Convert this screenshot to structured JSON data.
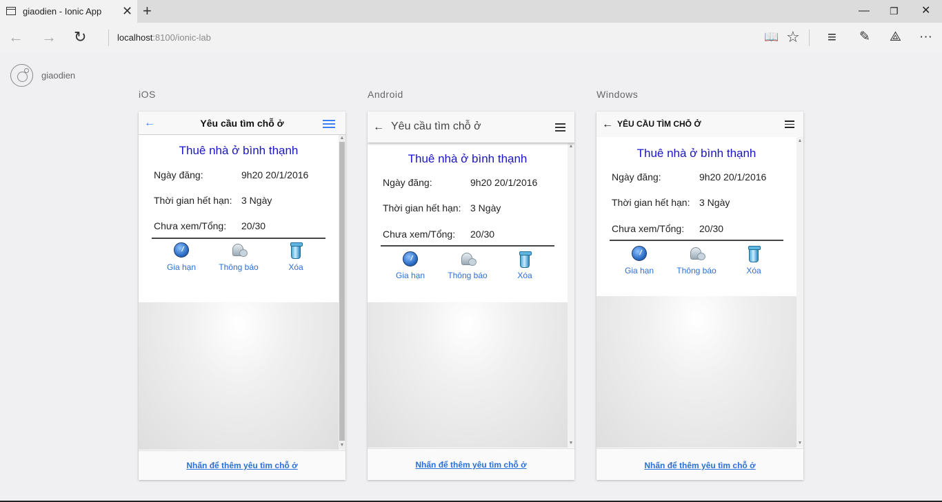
{
  "browser": {
    "tab_title": "giaodien - Ionic App",
    "tab_close": "✕",
    "new_tab": "+",
    "url_host": "localhost",
    "url_path": ":8100/ionic-lab",
    "controls": {
      "minimize": "—",
      "restore": "❐",
      "close": "✕"
    },
    "nav": {
      "back": "←",
      "forward": "→",
      "refresh": "↻"
    },
    "tools": {
      "reading_view": "📖",
      "favorite": "☆",
      "hub": "≡",
      "web_note": "✎",
      "share": "⟁",
      "more": "···"
    }
  },
  "app": {
    "name": "giaodien"
  },
  "platforms": [
    {
      "label": "iOS",
      "header_title": "Yêu cầu tìm chỗ ở",
      "back": "←",
      "post_title": "Thuê nhà ở bình thạnh",
      "rows": [
        {
          "label": "Ngày đăng:",
          "value": "9h20 20/1/2016"
        },
        {
          "label": "Thời gian hết hạn:",
          "value": "3 Ngày"
        },
        {
          "label": "Chưa xem/Tổng:",
          "value": "20/30"
        }
      ],
      "actions": [
        "Gia hạn",
        "Thông báo",
        "Xóa"
      ],
      "footer_link": "Nhấn để thêm yêu tìm chỗ ở"
    },
    {
      "label": "Android",
      "header_title": "Yêu cầu tìm chỗ ở",
      "back": "←",
      "post_title": "Thuê nhà ở bình thạnh",
      "rows": [
        {
          "label": "Ngày đăng:",
          "value": "9h20 20/1/2016"
        },
        {
          "label": "Thời gian hết hạn:",
          "value": "3 Ngày"
        },
        {
          "label": "Chưa xem/Tổng:",
          "value": "20/30"
        }
      ],
      "actions": [
        "Gia hạn",
        "Thông báo",
        "Xóa"
      ],
      "footer_link": "Nhấn để thêm yêu tìm chỗ ở"
    },
    {
      "label": "Windows",
      "header_title": "YÊU CẦU TÌM CHỖ Ở",
      "back": "←",
      "post_title": "Thuê nhà ở bình thạnh",
      "rows": [
        {
          "label": "Ngày đăng:",
          "value": "9h20 20/1/2016"
        },
        {
          "label": "Thời gian hết hạn:",
          "value": "3 Ngày"
        },
        {
          "label": "Chưa xem/Tổng:",
          "value": "20/30"
        }
      ],
      "actions": [
        "Gia hạn",
        "Thông báo",
        "Xóa"
      ],
      "footer_link": "Nhấn để thêm yêu tìm chỗ ở"
    }
  ],
  "colors": {
    "ios_accent": "#387ef5",
    "post_title": "#1a14c8",
    "action_label": "#2a6fd6"
  }
}
